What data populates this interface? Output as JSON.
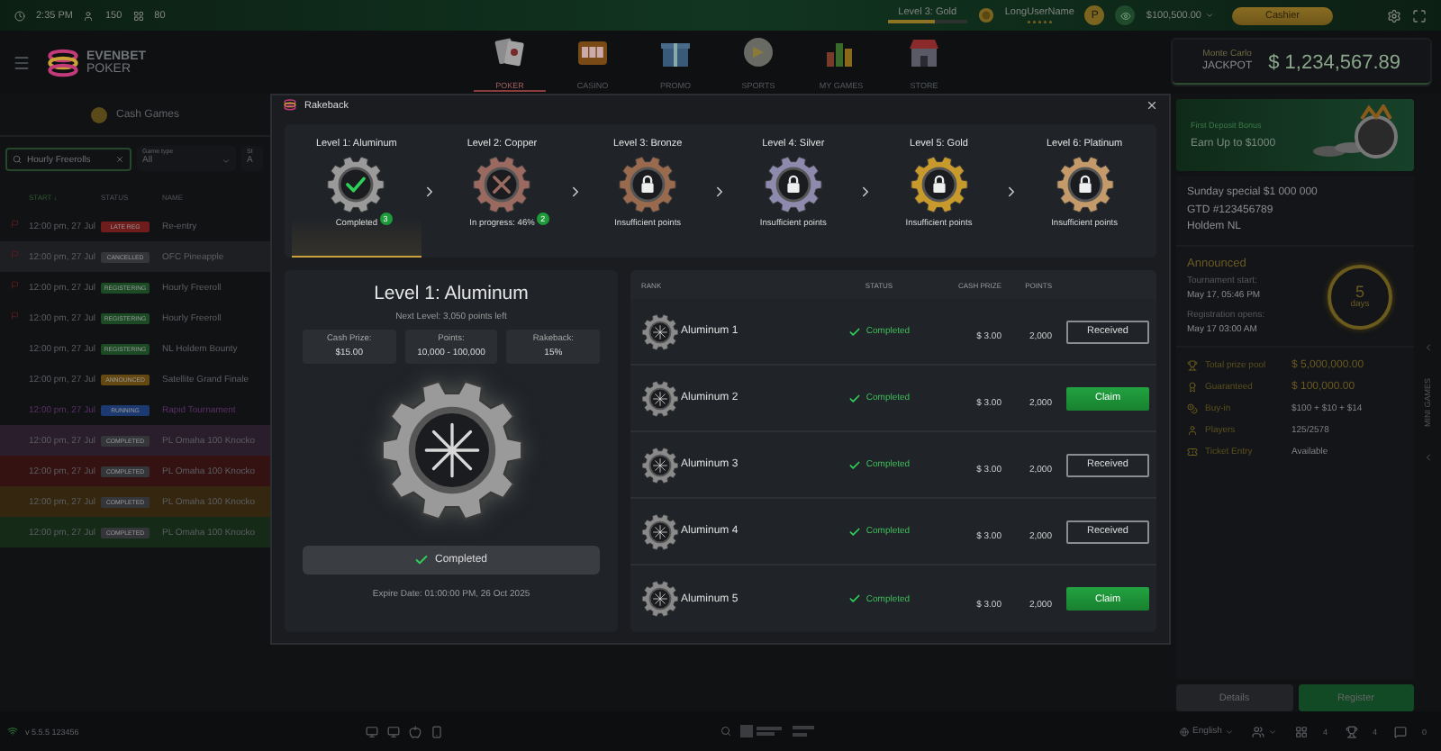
{
  "top_bar": {
    "time": "2:35 PM",
    "players": "150",
    "tables": "80",
    "level": {
      "label": "Level 3: Gold",
      "level": 0.6
    },
    "user": {
      "name": "LongUserName",
      "stars": 5,
      "avatar": "P"
    },
    "balance": "$100,500.00",
    "cashier": "Cashier"
  },
  "nav": {
    "brand": "EVENBET",
    "brand_sub": "POKER",
    "items": [
      {
        "label": "POKER",
        "kind": "poker",
        "selected": true
      },
      {
        "label": "CASINO",
        "kind": "casino",
        "selected": false
      },
      {
        "label": "PROMO",
        "kind": "promo",
        "selected": false
      },
      {
        "label": "SPORTS",
        "kind": "sports",
        "selected": false
      },
      {
        "label": "MY GAMES",
        "kind": "games",
        "selected": false
      },
      {
        "label": "STORE",
        "kind": "store",
        "selected": false
      }
    ],
    "jackpot": {
      "title": "Monte Carlo",
      "label": "JACKPOT",
      "amount": "$ 1,234,567.89"
    }
  },
  "lobby": {
    "tab": "Cash Games",
    "search": "Hourly Freerolls",
    "filters": [
      {
        "label": "Game type",
        "value": "All"
      },
      {
        "label": "St",
        "value": "A"
      }
    ],
    "columns": [
      "START ↓",
      "STATUS",
      "NAME"
    ],
    "rows": [
      {
        "start": "12:00 pm, 27 Jul",
        "status": {
          "label": "LATE REG",
          "color": "#6e1c1c"
        },
        "name": "Re-entry",
        "flagged": true,
        "accent": false,
        "color": "#111214"
      },
      {
        "start": "12:00 pm, 27 Jul",
        "status": {
          "label": "CANCELLED",
          "color": "#35363a"
        },
        "name": "OFC Pineapple",
        "flagged": true,
        "accent": false,
        "color": "#1e1f22"
      },
      {
        "start": "12:00 pm, 27 Jul",
        "status": {
          "label": "REGISTERING",
          "color": "#1b4a24"
        },
        "name": "Hourly Freeroll",
        "flagged": true,
        "accent": false,
        "color": "#111214"
      },
      {
        "start": "12:00 pm, 27 Jul",
        "status": {
          "label": "REGISTERING",
          "color": "#1b4a24"
        },
        "name": "Hourly Freeroll",
        "flagged": true,
        "accent": false,
        "color": "#111214"
      },
      {
        "start": "12:00 pm, 27 Jul",
        "status": {
          "label": "REGISTERING",
          "color": "#1b4a24"
        },
        "name": "NL Holdem Bounty",
        "flagged": false,
        "accent": false,
        "color": "#111214"
      },
      {
        "start": "12:00 pm, 27 Jul",
        "status": {
          "label": "ANNOUNCED",
          "color": "#634812"
        },
        "name": "Satellite Grand Finale",
        "flagged": false,
        "accent": false,
        "color": "#111214"
      },
      {
        "start": "12:00 pm, 27 Jul",
        "status": {
          "label": "RUNNING",
          "color": "#1c3a70"
        },
        "name": "Rapid Tournament",
        "flagged": false,
        "accent": true,
        "color": "#111214"
      },
      {
        "start": "12:00 pm, 27 Jul",
        "status": {
          "label": "COMPLETED",
          "color": "#35363a"
        },
        "name": "PL Omaha 100 Knocko",
        "flagged": false,
        "accent": false,
        "color": "#2a1d2c"
      },
      {
        "start": "12:00 pm, 27 Jul",
        "status": {
          "label": "COMPLETED",
          "color": "#35363a"
        },
        "name": "PL Omaha 100 Knocko",
        "flagged": false,
        "accent": false,
        "color": "#341212"
      },
      {
        "start": "12:00 pm, 27 Jul",
        "status": {
          "label": "COMPLETED",
          "color": "#35363a"
        },
        "name": "PL Omaha 100 Knocko",
        "flagged": false,
        "accent": false,
        "color": "#35270f"
      },
      {
        "start": "12:00 pm, 27 Jul",
        "status": {
          "label": "COMPLETED",
          "color": "#35363a"
        },
        "name": "PL Omaha 100 Knocko",
        "flagged": false,
        "accent": false,
        "color": "#152b18"
      }
    ]
  },
  "rakeback": {
    "title": "Rakeback",
    "levels": [
      {
        "name": "Level 1: Aluminum",
        "kind": "completed",
        "status": "Completed",
        "badge": "3",
        "color": "#9a9a9a",
        "selected": true
      },
      {
        "name": "Level 2: Copper",
        "kind": "progress",
        "status": "In progress: 46%",
        "badge": "2",
        "color": "#9a6a60",
        "selected": false
      },
      {
        "name": "Level 3: Bronze",
        "kind": "locked",
        "status": "Insufficient points",
        "color": "#9a6a4e",
        "selected": false
      },
      {
        "name": "Level 4: Silver",
        "kind": "locked",
        "status": "Insufficient points",
        "color": "#8e8aae",
        "selected": false
      },
      {
        "name": "Level 5: Gold",
        "kind": "locked",
        "status": "Insufficient points",
        "color": "#c89a2c",
        "selected": false
      },
      {
        "name": "Level 6: Platinum",
        "kind": "locked",
        "status": "Insufficient points",
        "color": "#c49a6a",
        "selected": false
      }
    ],
    "detail": {
      "title": "Level 1: Aluminum",
      "next": "Next Level: 3,050 points left",
      "stats": [
        {
          "label": "Cash Prize:",
          "value": "$15.00"
        },
        {
          "label": "Points:",
          "value": "10,000 - 100,000"
        },
        {
          "label": "Rakeback:",
          "value": "15%"
        }
      ],
      "status": "Completed",
      "expire": "Expire Date: 01:00:00 PM, 26 Oct 2025"
    },
    "ranks": {
      "columns": [
        "RANK",
        "STATUS",
        "CASH PRIZE",
        "POINTS"
      ],
      "rows": [
        {
          "rank": "Aluminum 1",
          "status": "Completed",
          "prize": "$ 3.00",
          "points": "2,000",
          "action": {
            "label": "Received",
            "kind": "received"
          }
        },
        {
          "rank": "Aluminum 2",
          "status": "Completed",
          "prize": "$ 3.00",
          "points": "2,000",
          "action": {
            "label": "Claim",
            "kind": "claim"
          }
        },
        {
          "rank": "Aluminum 3",
          "status": "Completed",
          "prize": "$ 3.00",
          "points": "2,000",
          "action": {
            "label": "Received",
            "kind": "received"
          }
        },
        {
          "rank": "Aluminum 4",
          "status": "Completed",
          "prize": "$ 3.00",
          "points": "2,000",
          "action": {
            "label": "Received",
            "kind": "received"
          }
        },
        {
          "rank": "Aluminum 5",
          "status": "Completed",
          "prize": "$ 3.00",
          "points": "2,000",
          "action": {
            "label": "Claim",
            "kind": "claim"
          }
        }
      ]
    }
  },
  "tournament": {
    "banner": {
      "title": "First Deposit Bonus",
      "text": "Earn Up to $1000"
    },
    "name": [
      "Sunday special $1 000 000",
      "GTD #123456789",
      "Holdem NL"
    ],
    "state": "Announced",
    "start_label": "Tournament start:",
    "start": "May 17, 05:46 PM",
    "reg_label": "Registration opens:",
    "reg": "May 17 03:00 AM",
    "countdown": {
      "value": "5",
      "unit": "days"
    },
    "details": [
      {
        "kind": "prize",
        "label": "Total prize pool",
        "value": "$ 5,000,000.00",
        "highlight": true
      },
      {
        "kind": "guaranteed",
        "label": "Guaranteed",
        "value": "$ 100,000.00",
        "highlight": true
      },
      {
        "kind": "buyin",
        "label": "Buy-in",
        "value": "$100 + $10 + $14",
        "highlight": false
      },
      {
        "kind": "players",
        "label": "Players",
        "value": "125/2578",
        "highlight": false
      },
      {
        "kind": "ticket",
        "label": "Ticket Entry",
        "value": "Available",
        "highlight": false
      }
    ],
    "buttons": [
      {
        "label": "Details",
        "kind": "secondary"
      },
      {
        "label": "Register",
        "kind": "primary"
      }
    ]
  },
  "mini_games": "MINI GAMES",
  "bottom_bar": {
    "version": "v 5.5.5 123456",
    "language": "English",
    "counters": [
      {
        "kind": "tables",
        "value": "4"
      },
      {
        "kind": "tournaments",
        "value": "4"
      },
      {
        "kind": "messages",
        "value": "0"
      }
    ]
  }
}
